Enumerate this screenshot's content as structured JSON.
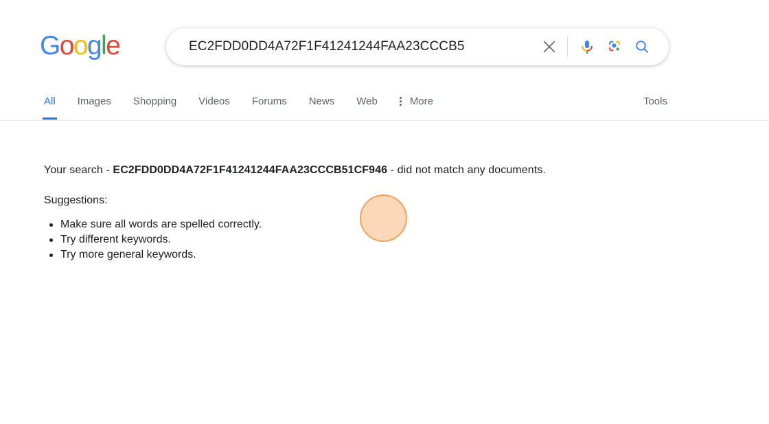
{
  "brand": {
    "logo_letters": [
      {
        "char": "G",
        "color": "#4285F4"
      },
      {
        "char": "o",
        "color": "#EA4335"
      },
      {
        "char": "o",
        "color": "#FBBC05"
      },
      {
        "char": "g",
        "color": "#4285F4"
      },
      {
        "char": "l",
        "color": "#34A853"
      },
      {
        "char": "e",
        "color": "#EA4335"
      }
    ],
    "logo_text": "Google"
  },
  "search": {
    "value": "EC2FDD0DD4A72F1F41241244FAA23CCCB5",
    "placeholder": "Search",
    "clear_label": "Clear",
    "voice_label": "Search by voice",
    "lens_label": "Search by image",
    "submit_label": "Google Search"
  },
  "nav": {
    "tabs": [
      {
        "label": "All",
        "active": true
      },
      {
        "label": "Images",
        "active": false
      },
      {
        "label": "Shopping",
        "active": false
      },
      {
        "label": "Videos",
        "active": false
      },
      {
        "label": "Forums",
        "active": false
      },
      {
        "label": "News",
        "active": false
      },
      {
        "label": "Web",
        "active": false
      }
    ],
    "more_label": "More",
    "tools_label": "Tools"
  },
  "results": {
    "no_match_prefix": "Your search - ",
    "query": "EC2FDD0DD4A72F1F41241244FAA23CCCB51CF946",
    "no_match_suffix": " - did not match any documents.",
    "suggestions_title": "Suggestions:",
    "suggestions": [
      "Make sure all words are spelled correctly.",
      "Try different keywords.",
      "Try more general keywords."
    ]
  },
  "cursor": {
    "fill_color": "#fbd9b8",
    "border_color": "#f5a15c"
  }
}
